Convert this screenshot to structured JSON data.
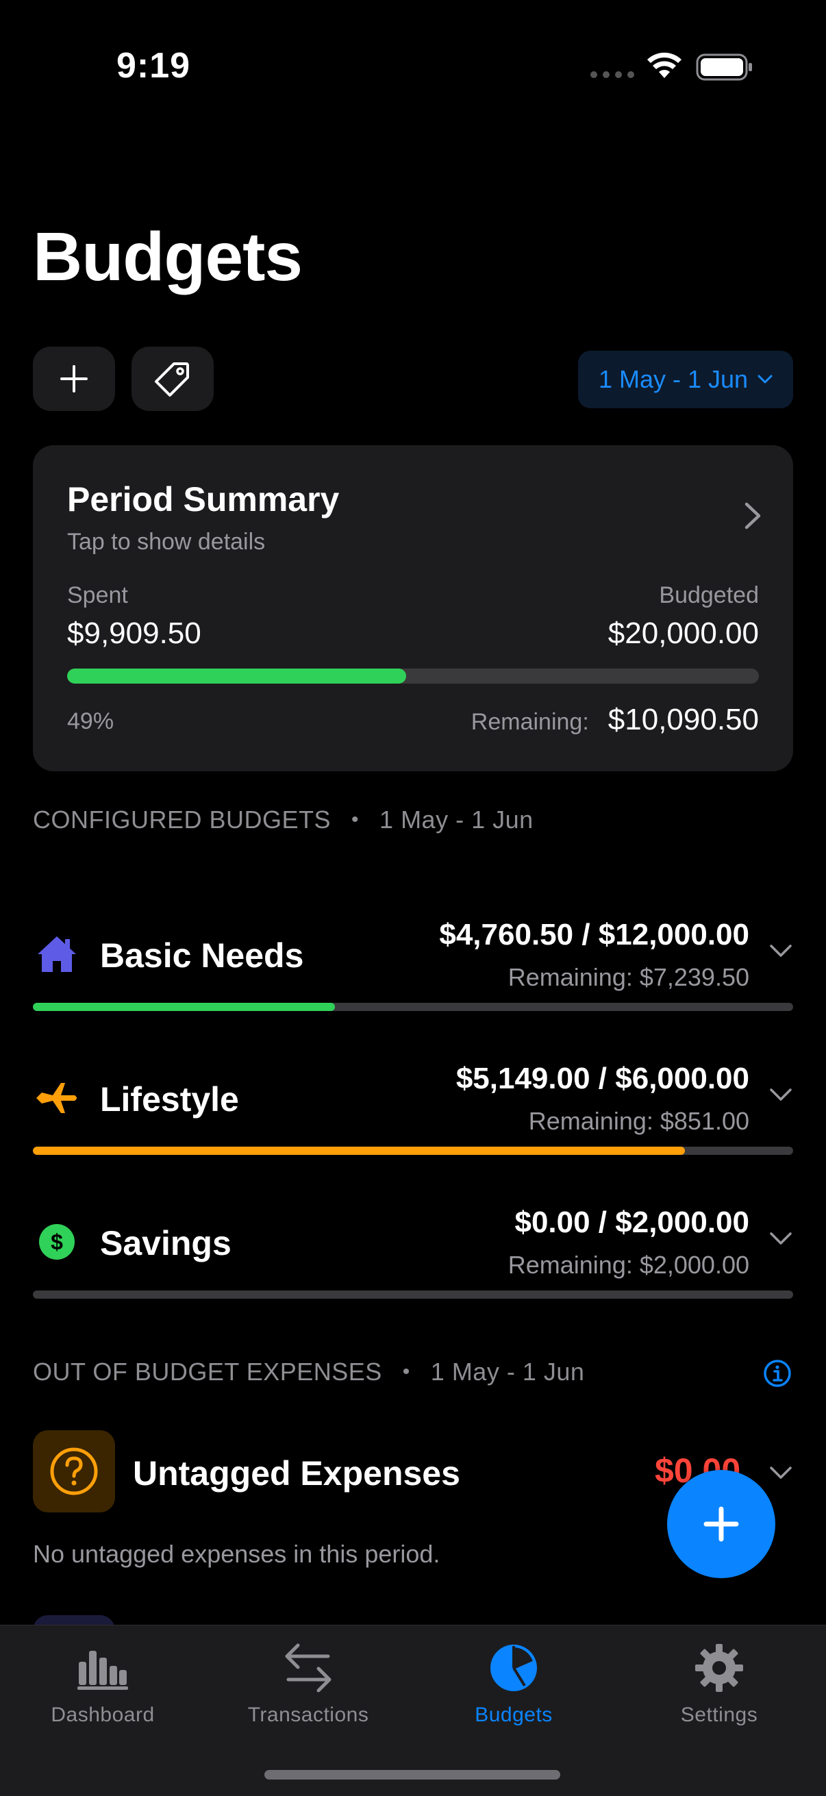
{
  "status_bar": {
    "time": "9:19"
  },
  "page": {
    "title": "Budgets"
  },
  "toolbar": {
    "period_label": "1 May - 1 Jun"
  },
  "summary": {
    "title": "Period Summary",
    "subtitle": "Tap to show details",
    "spent_label": "Spent",
    "spent": "$9,909.50",
    "budgeted_label": "Budgeted",
    "budgeted": "$20,000.00",
    "percent": "49%",
    "progress_fraction": 0.49,
    "remaining_label": "Remaining:",
    "remaining": "$10,090.50",
    "bar_color": "#30d158"
  },
  "configured": {
    "header": "CONFIGURED BUDGETS",
    "period": "1 May - 1 Jun",
    "items": [
      {
        "name": "Basic Needs",
        "icon": "house-icon",
        "amount": "$4,760.50 / $12,000.00",
        "remaining": "Remaining: $7,239.50",
        "progress_fraction": 0.397,
        "color": "#30d158",
        "icon_color": "#5e5ce6"
      },
      {
        "name": "Lifestyle",
        "icon": "airplane-icon",
        "amount": "$5,149.00 / $6,000.00",
        "remaining": "Remaining: $851.00",
        "progress_fraction": 0.858,
        "color": "#ff9f0a",
        "icon_color": "#ff9f0a"
      },
      {
        "name": "Savings",
        "icon": "dollar-circle-icon",
        "amount": "$0.00 / $2,000.00",
        "remaining": "Remaining: $2,000.00",
        "progress_fraction": 0,
        "color": "#30d158",
        "icon_color": "#30d158"
      }
    ]
  },
  "out_of_budget": {
    "header": "OUT OF BUDGET EXPENSES",
    "period": "1 May - 1 Jun",
    "untagged_name": "Untagged Expenses",
    "untagged_amount": "$0.00",
    "empty_text": "No untagged expenses in this period.",
    "amount_color": "#ff453a"
  },
  "tabs": [
    {
      "label": "Dashboard",
      "icon": "bar-chart-icon",
      "active": false
    },
    {
      "label": "Transactions",
      "icon": "arrows-swap-icon",
      "active": false
    },
    {
      "label": "Budgets",
      "icon": "pie-chart-icon",
      "active": true
    },
    {
      "label": "Settings",
      "icon": "gear-icon",
      "active": false
    }
  ],
  "colors": {
    "accent": "#0a84ff",
    "background": "#000000",
    "card": "#1c1c1e"
  }
}
